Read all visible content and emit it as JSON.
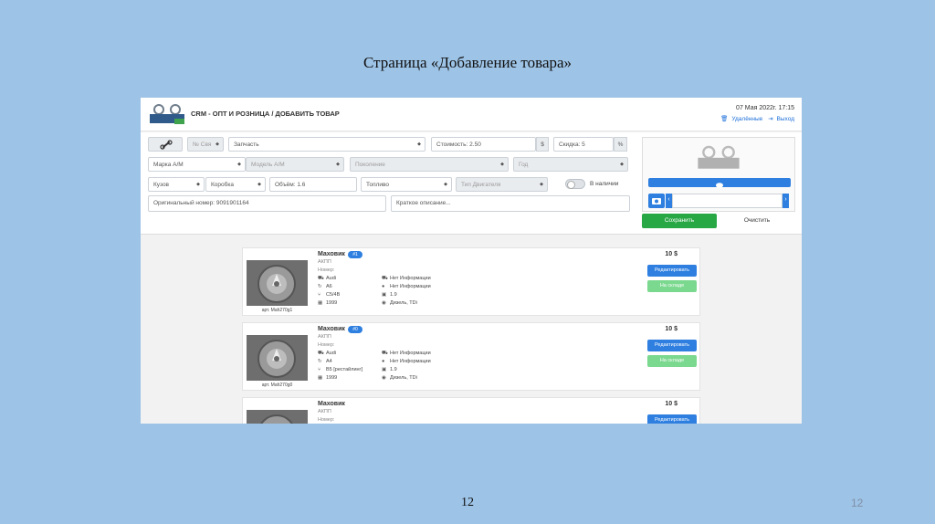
{
  "slide": {
    "title": "Страница «Добавление товара»",
    "page_number_center": "12",
    "page_number_right": "12"
  },
  "header": {
    "logo_text": "ШРОТ",
    "crm_title": "CRM - ОПТ И РОЗНИЦА / ДОБАВИТЬ ТОВАР",
    "date": "07 Мая 2022г. 17:15",
    "deleted_link": "Удалённые",
    "exit_link": "Выход"
  },
  "form": {
    "num_placeholder": "№ Свя",
    "category_value": "Запчасть",
    "cost_placeholder": "Стоимость: 2.50",
    "cost_currency": "$",
    "discount_placeholder": "Скидка: 5",
    "discount_unit": "%",
    "brand_value": "Марка А/М",
    "model_placeholder": "Модель А/М",
    "generation_placeholder": "Поколение",
    "year_placeholder": "Год",
    "body_value": "Кузов",
    "gearbox_value": "Коробка",
    "volume_placeholder": "Объём: 1.6",
    "fuel_value": "Топливо",
    "engine_type_placeholder": "Тип Двигателя",
    "in_stock_label": "В наличии",
    "original_number_placeholder": "Оригинальный номер: 9091901164",
    "short_desc_placeholder": "Краткое описание...",
    "save_label": "Сохранить",
    "clear_label": "Очистить"
  },
  "products": [
    {
      "name": "Маховик",
      "badge": "#1",
      "category": "АКПП",
      "number_label": "Номер:",
      "brand": "Audi",
      "model": "A6",
      "generation": "C5/4B",
      "year": "1999",
      "info1": "Нет Информации",
      "info2": "Нет Информации",
      "volume": "1.9",
      "fuel": "Дизель, TDi",
      "price": "10 $",
      "article": "арт. Mah270g1",
      "edit_label": "Редактировать",
      "stock_label": "На складе"
    },
    {
      "name": "Маховик",
      "badge": "#0",
      "category": "АКПП",
      "number_label": "Номер:",
      "brand": "Audi",
      "model": "A4",
      "generation": "B5 [рестайлинг]",
      "year": "1999",
      "info1": "Нет Информации",
      "info2": "Нет Информации",
      "volume": "1.9",
      "fuel": "Дизель, TDi",
      "price": "10 $",
      "article": "арт. Mah270g0",
      "edit_label": "Редактировать",
      "stock_label": "На складе"
    },
    {
      "name": "Маховик",
      "category": "АКПП",
      "number_label": "Номер:",
      "price": "10 $",
      "edit_label": "Редактировать"
    }
  ]
}
